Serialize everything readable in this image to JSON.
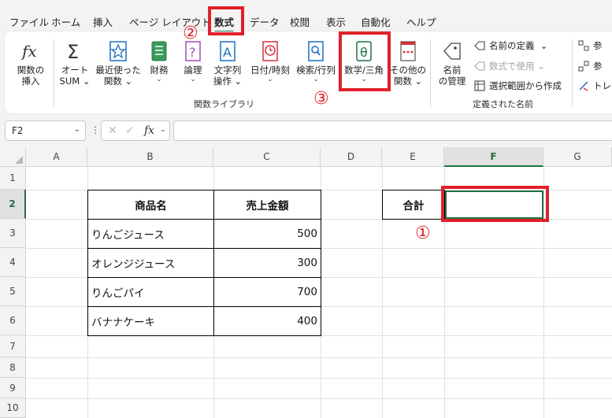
{
  "menu": {
    "tabs": [
      "ファイル",
      "ホーム",
      "挿入",
      "ページ レイアウト",
      "数式",
      "データ",
      "校閲",
      "表示",
      "自動化",
      "ヘルプ"
    ],
    "active_index": 4
  },
  "ribbon": {
    "insert_function": {
      "line1": "関数の",
      "line2": "挿入"
    },
    "autosum": {
      "line1": "オート",
      "line2": "SUM"
    },
    "recent": {
      "line1": "最近使った",
      "line2": "関数"
    },
    "financial": {
      "line1": "財務"
    },
    "logical": {
      "line1": "論理"
    },
    "text": {
      "line1": "文字列",
      "line2": "操作"
    },
    "datetime": {
      "line1": "日付/時刻"
    },
    "lookup": {
      "line1": "検索/行列"
    },
    "math": {
      "line1": "数学/三角"
    },
    "more": {
      "line1": "その他の",
      "line2": "関数"
    },
    "library_label": "関数ライブラリ",
    "name_manager": {
      "line1": "名前",
      "line2": "の管理"
    },
    "define_name": "名前の定義",
    "use_in_formula": "数式で使用",
    "create_from_selection": "選択範囲から作成",
    "defined_names_label": "定義された名前",
    "right_cut_1": "参",
    "right_cut_2": "参",
    "right_cut_3": "トレ"
  },
  "formula_bar": {
    "name_box": "F2",
    "fx": "fx",
    "value": ""
  },
  "sheet": {
    "columns": [
      "A",
      "B",
      "C",
      "D",
      "E",
      "F",
      "G"
    ],
    "rows": [
      "1",
      "2",
      "3",
      "4",
      "5",
      "6",
      "7",
      "8",
      "9",
      "10"
    ],
    "selected_column": "F",
    "selected_row": "2",
    "table": {
      "headers": [
        "商品名",
        "売上金額"
      ],
      "rows": [
        {
          "name": "りんごジュース",
          "amount": "500"
        },
        {
          "name": "オレンジジュース",
          "amount": "300"
        },
        {
          "name": "りんごパイ",
          "amount": "700"
        },
        {
          "name": "バナナケーキ",
          "amount": "400"
        }
      ]
    },
    "total_label": "合計",
    "total_value": ""
  },
  "annotations": {
    "step1": "①",
    "step2": "②",
    "step3": "③",
    "color": "#e0202a"
  },
  "colors": {
    "accent": "#1e7145"
  }
}
